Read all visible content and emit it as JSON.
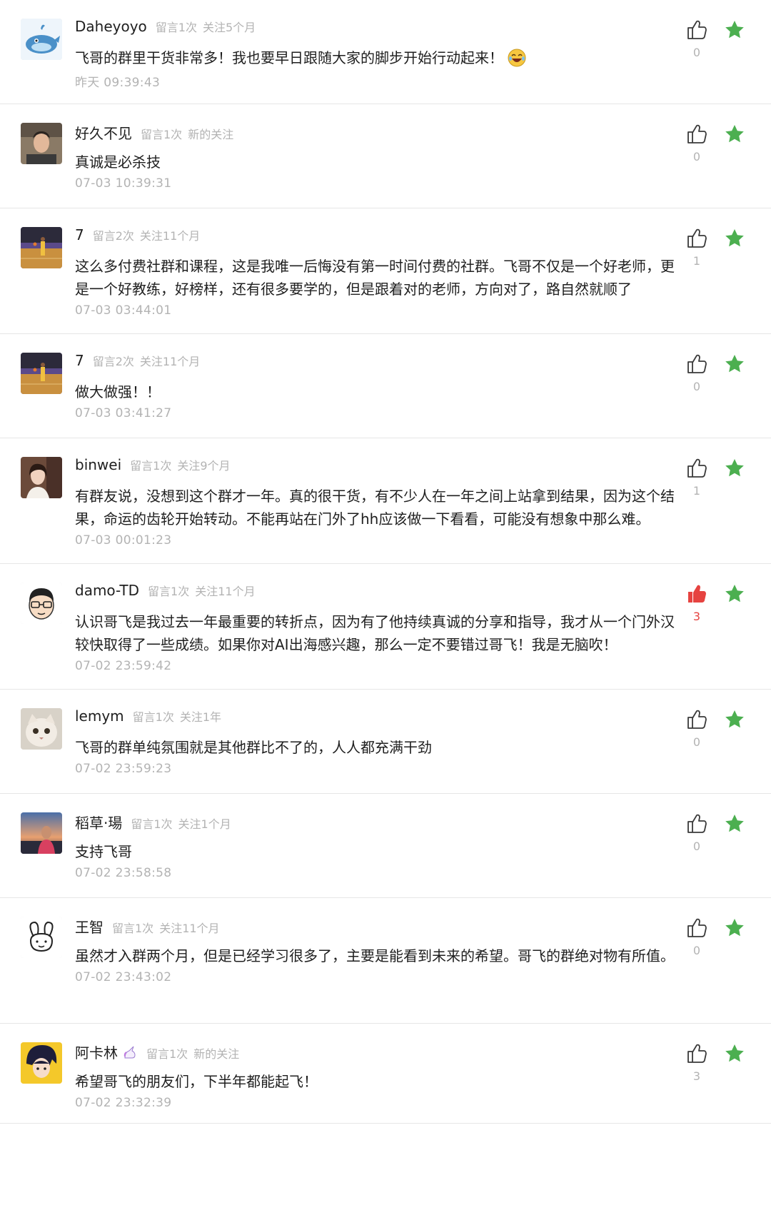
{
  "colors": {
    "star": "#4caf50",
    "liked": "#e64340",
    "muted": "#b3b3b3",
    "divider": "#e6e6e6"
  },
  "comments": [
    {
      "name": "Daheyoyo",
      "tags": [
        "留言1次",
        "关注5个月"
      ],
      "text": "飞哥的群里干货非常多！我也要早日跟随大家的脚步开始行动起来！",
      "time": "昨天 09:39:43",
      "likes": "0",
      "liked": false,
      "emoji": "laughing-tears-emoji",
      "avatar": "whale-avatar"
    },
    {
      "name": "好久不见",
      "tags": [
        "留言1次",
        "新的关注"
      ],
      "text": "真诚是必杀技",
      "time": "07-03 10:39:31",
      "likes": "0",
      "liked": false,
      "avatar": "photo-man-avatar"
    },
    {
      "name": "7",
      "tags": [
        "留言2次",
        "关注11个月"
      ],
      "text": "这么多付费社群和课程，这是我唯一后悔没有第一时间付费的社群。飞哥不仅是一个好老师，更是一个好教练，好榜样，还有很多要学的，但是跟着对的老师，方向对了，路自然就顺了",
      "time": "07-03 03:44:01",
      "likes": "1",
      "liked": false,
      "avatar": "basketball-court-avatar"
    },
    {
      "name": "7",
      "tags": [
        "留言2次",
        "关注11个月"
      ],
      "text": "做大做强！！",
      "time": "07-03 03:41:27",
      "likes": "0",
      "liked": false,
      "avatar": "basketball-court-avatar"
    },
    {
      "name": "binwei",
      "tags": [
        "留言1次",
        "关注9个月"
      ],
      "text": "有群友说，没想到这个群才一年。真的很干货，有不少人在一年之间上站拿到结果，因为这个结果，命运的齿轮开始转动。不能再站在门外了hh应该做一下看看，可能没有想象中那么难。",
      "time": "07-03 00:01:23",
      "likes": "1",
      "liked": false,
      "avatar": "photo-woman-avatar"
    },
    {
      "name": "damo-TD",
      "tags": [
        "留言1次",
        "关注11个月"
      ],
      "text": "认识哥飞是我过去一年最重要的转折点，因为有了他持续真诚的分享和指导，我才从一个门外汉较快取得了一些成绩。如果你对AI出海感兴趣，那么一定不要错过哥飞！我是无脑吹！",
      "time": "07-02 23:59:42",
      "likes": "3",
      "liked": true,
      "avatar": "cartoon-glasses-avatar"
    },
    {
      "name": "lemym",
      "tags": [
        "留言1次",
        "关注1年"
      ],
      "text": "飞哥的群单纯氛围就是其他群比不了的，人人都充满干劲",
      "time": "07-02 23:59:23",
      "likes": "0",
      "liked": false,
      "avatar": "cat-avatar"
    },
    {
      "name": "稻草·瑒",
      "tags": [
        "留言1次",
        "关注1个月"
      ],
      "text": "支持飞哥",
      "time": "07-02 23:58:58",
      "likes": "0",
      "liked": false,
      "avatar": "sunset-photo-avatar"
    },
    {
      "name": "王智",
      "tags": [
        "留言1次",
        "关注11个月"
      ],
      "text": "虽然才入群两个月，但是已经学习很多了，主要是能看到未来的希望。哥飞的群绝对物有所值。",
      "time": "07-02 23:43:02",
      "likes": "0",
      "liked": false,
      "avatar": "rabbit-doodle-avatar"
    },
    {
      "name": "阿卡林",
      "tags": [
        "留言1次",
        "新的关注"
      ],
      "text": "希望哥飞的朋友们，下半年都能起飞！",
      "time": "07-02 23:32:39",
      "likes": "3",
      "liked": false,
      "avatar": "anime-avatar",
      "name_badge": "unicorn-icon"
    }
  ]
}
